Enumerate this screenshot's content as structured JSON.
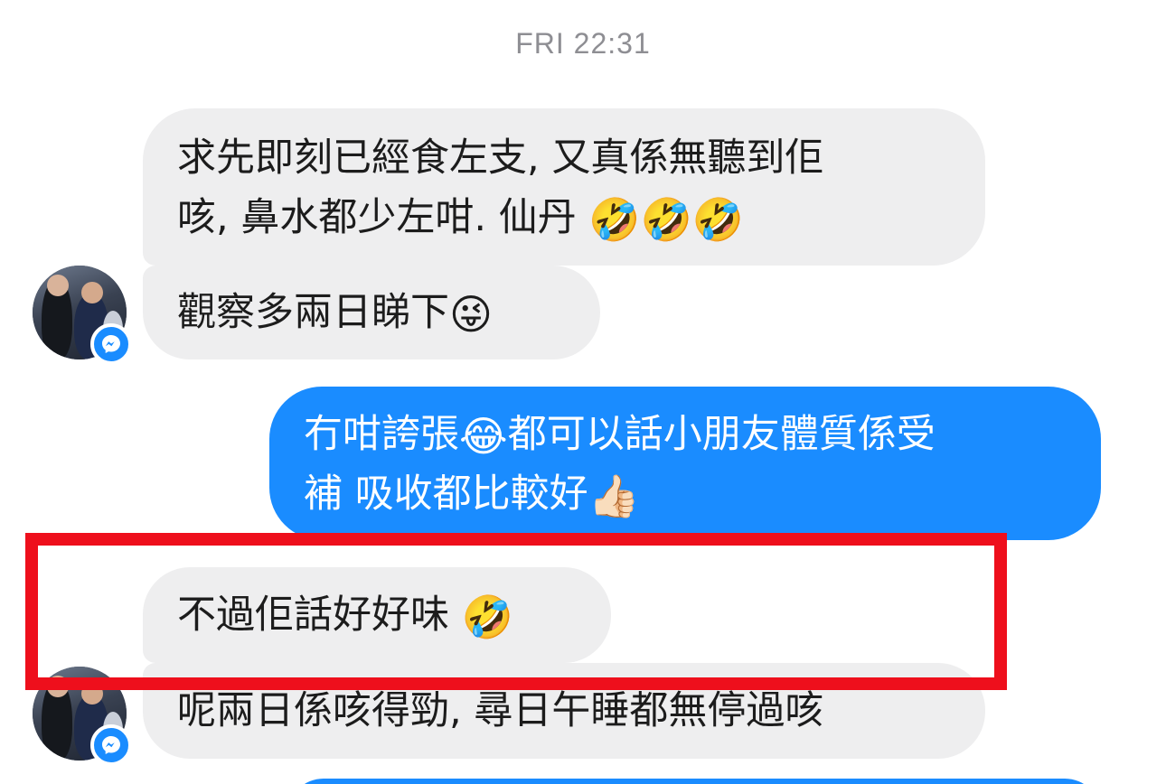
{
  "timestamp": "FRI 22:31",
  "messages": [
    {
      "direction": "incoming",
      "lines": [
        "求先即刻已經食左支, 又真係無聽到佢",
        "咳, 鼻水都少左咁. 仙丹"
      ],
      "emoji": [
        "🤣",
        "🤣",
        "🤣"
      ]
    },
    {
      "direction": "incoming",
      "text": "觀察多兩日睇下",
      "emoji": "😜"
    },
    {
      "direction": "outgoing",
      "line1_a": "冇咁誇張",
      "line1_emoji": "😂",
      "line1_b": "都可以話小朋友體質係受",
      "line2": "補 吸收都比較好",
      "line2_emoji": "👍🏻"
    },
    {
      "direction": "incoming",
      "text": "不過佢話好好味",
      "emoji": "🤣",
      "highlighted": true
    },
    {
      "direction": "incoming",
      "text": "呢兩日係咳得勁, 尋日午睡都無停過咳"
    }
  ],
  "colors": {
    "incoming_bubble": "#eeeeef",
    "outgoing_bubble": "#1a8cff",
    "highlight": "#ee0f1c",
    "timestamp": "#8e8e93"
  },
  "icons": {
    "contact_avatar": "avatar",
    "messenger_badge": "messenger-icon"
  }
}
